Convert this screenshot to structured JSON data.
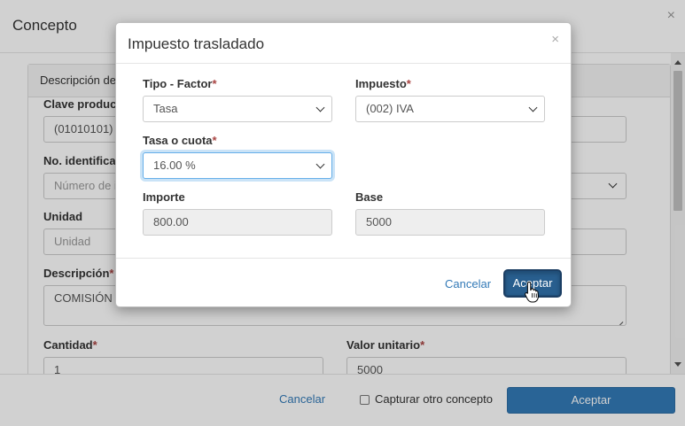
{
  "outer": {
    "title": "Concepto",
    "close_glyph": "×",
    "panel_heading": "Descripción del",
    "fields": {
      "clave_label": "Clave product",
      "clave_value": "(01010101) N",
      "no_ident_label": "No. identificad",
      "no_ident_placeholder": "Número de id",
      "unidad_label": "Unidad",
      "unidad_placeholder": "Unidad",
      "descripcion_label": "Descripción",
      "descripcion_value": "COMISIÓN B",
      "cantidad_label": "Cantidad",
      "cantidad_value": "1",
      "valor_unitario_label": "Valor unitario",
      "valor_unitario_value": "5000"
    },
    "required_mark": "*",
    "footer": {
      "cancel_label": "Cancelar",
      "capture_label": "Capturar otro concepto",
      "capture_checked": false,
      "accept_label": "Aceptar"
    }
  },
  "inner": {
    "title": "Impuesto trasladado",
    "close_glyph": "×",
    "tipo_factor_label": "Tipo - Factor",
    "tipo_factor_value": "Tasa",
    "impuesto_label": "Impuesto",
    "impuesto_value": "(002) IVA",
    "tasa_label": "Tasa o cuota",
    "tasa_value": "16.00 %",
    "importe_label": "Importe",
    "importe_value": "800.00",
    "base_label": "Base",
    "base_value": "5000",
    "cancel_label": "Cancelar",
    "accept_label": "Aceptar"
  },
  "colors": {
    "link": "#337ab7",
    "primary": "#337ab7",
    "primary_active": "#285e8e",
    "required": "#a94442"
  }
}
